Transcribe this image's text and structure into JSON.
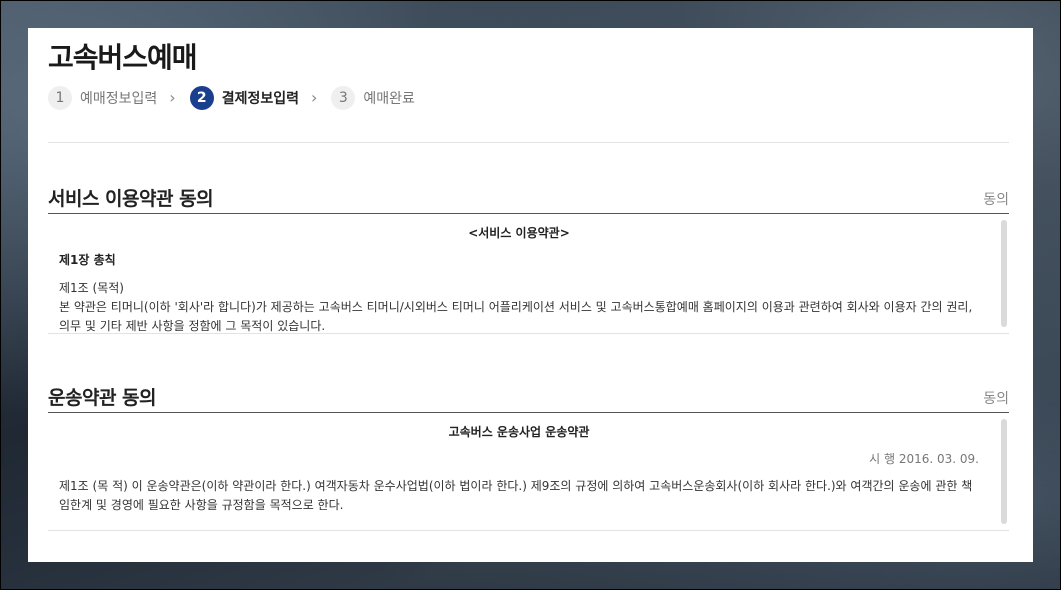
{
  "page": {
    "title": "고속버스예매"
  },
  "steps": [
    {
      "num": "1",
      "label": "예매정보입력",
      "active": false
    },
    {
      "num": "2",
      "label": "결제정보입력",
      "active": true
    },
    {
      "num": "3",
      "label": "예매완료",
      "active": false
    }
  ],
  "sections": {
    "service": {
      "title": "서비스 이용약관 동의",
      "agree_label": "동의",
      "heading": "<서비스 이용약관>",
      "chapter": "제1장 총칙",
      "article_title": "제1조 (목적)",
      "article_body": "본 약관은 티머니(이하 '회사'라 합니다)가 제공하는 고속버스 티머니/시외버스 티머니 어플리케이션 서비스 및 고속버스통합예매 홈페이지의 이용과 관련하여 회사와 이용자 간의 권리, 의무 및 기타 제반 사항을 정함에 그 목적이 있습니다."
    },
    "transport": {
      "title": "운송약관 동의",
      "agree_label": "동의",
      "heading": "고속버스 운송사업 운송약관",
      "effective": "시 행 2016. 03. 09.",
      "article_body": "제1조 (목 적) 이 운송약관은(이하 약관이라 한다.) 여객자동차 운수사업법(이하 법이라 한다.) 제9조의 규정에 의하여 고속버스운송회사(이하 회사라 한다.)와 여객간의 운송에 관한 책임한계 및 경영에 필요한 사항을 규정함을 목적으로 한다."
    }
  },
  "colors": {
    "accent": "#1a3f8f",
    "muted": "#888888",
    "panel": "#ffffff"
  }
}
